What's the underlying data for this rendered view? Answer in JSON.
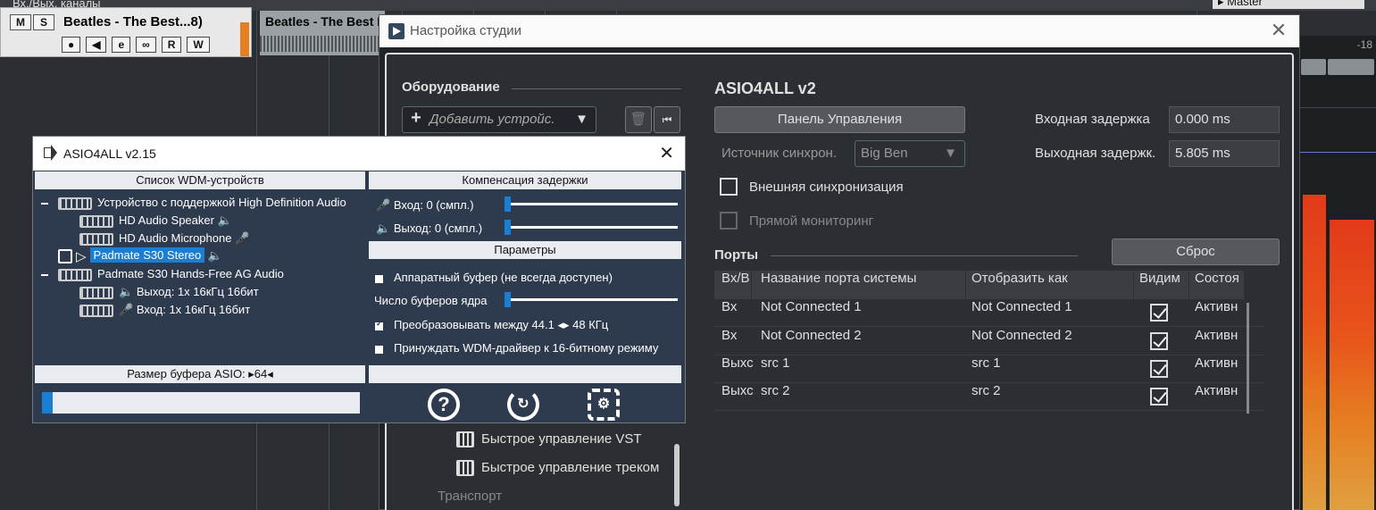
{
  "daw": {
    "channels_label": "Вх./Вых. каналы",
    "track": {
      "mute": "M",
      "solo": "S",
      "name": "Beatles - The Best...8)",
      "buttons": [
        "●",
        "◀",
        "e",
        "∞",
        "R",
        "W"
      ]
    },
    "clip_name": "Beatles - The Best II",
    "master_label": "▸ Master",
    "db_value": "-18"
  },
  "studio": {
    "title": "Настройка студии",
    "hardware_heading": "Оборудование",
    "add_device_placeholder": "Добавить устройс.",
    "driver_title": "ASIO4ALL v2",
    "control_panel_button": "Панель Управления",
    "sync_source_label": "Источник синхрон.",
    "sync_source_value": "Big Ben",
    "input_latency_label": "Входная задержка",
    "input_latency_value": "0.000 ms",
    "output_latency_label": "Выходная задержк.",
    "output_latency_value": "5.805 ms",
    "external_sync_label": "Внешняя синхронизация",
    "direct_monitoring_label": "Прямой мониторинг",
    "ports_heading": "Порты",
    "reset_button": "Сброс",
    "ports_columns": [
      "Вх/В",
      "Название порта системы",
      "Отобразить как",
      "Видим",
      "Состоя"
    ],
    "ports_rows": [
      {
        "dir": "Вх",
        "name": "Not Connected 1",
        "display": "Not Connected 1",
        "visible": true,
        "state": "Активн"
      },
      {
        "dir": "Вх",
        "name": "Not Connected 2",
        "display": "Not Connected 2",
        "visible": true,
        "state": "Активн"
      },
      {
        "dir": "Выхс",
        "name": "src 1",
        "display": "src 1",
        "visible": true,
        "state": "Активн"
      },
      {
        "dir": "Выхс",
        "name": "src 2",
        "display": "src 2",
        "visible": true,
        "state": "Активн"
      }
    ],
    "tree_items": [
      "Быстрое управление VST",
      "Быстрое управление треком",
      "Транспорт"
    ]
  },
  "asio": {
    "title": "ASIO4ALL v2.15",
    "wdm_list_header": "Список WDM-устройств",
    "latency_header": "Компенсация задержки",
    "params_header": "Параметры",
    "devices": [
      "Устройство с поддержкой High Definition Audio",
      "HD Audio Speaker",
      "HD Audio Microphone",
      "Padmate S30 Stereo",
      "Padmate S30 Hands-Free AG Audio",
      "Выход: 1х 16кГц 16бит",
      "Вход: 1х 16кГц 16бит"
    ],
    "latency_in": "Вход: 0 (смпл.)",
    "latency_out": "Выход: 0 (смпл.)",
    "hw_buffer": "Аппаратный буфер (не всегда доступен)",
    "buffer_count": "Число буферов ядра",
    "convert": "Преобразовывать между 44.1 ◂▸ 48 КГц",
    "force16": "Принуждать WDM-драйвер к 16-битному режиму",
    "buffer_size": "Размер буфера ASIO: ▸64◂"
  }
}
